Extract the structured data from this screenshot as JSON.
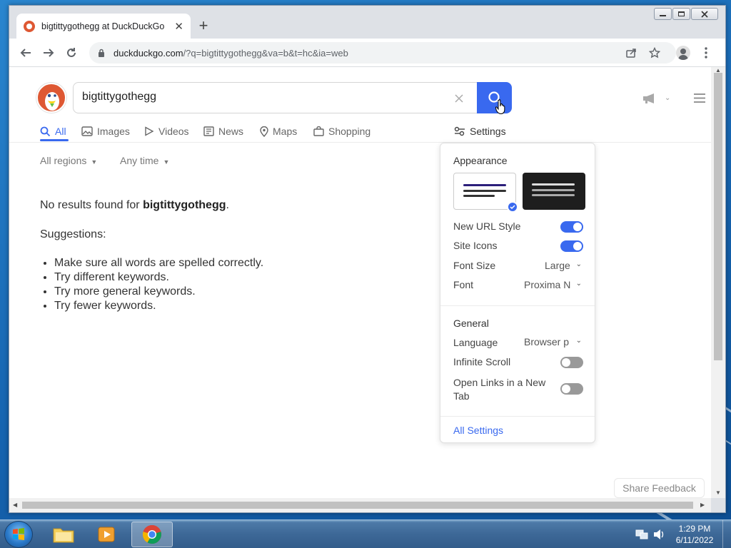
{
  "browser": {
    "tab_title": "bigtittygothegg at DuckDuckGo",
    "url_host": "duckduckgo.com",
    "url_rest": "/?q=bigtittygothegg&va=b&t=hc&ia=web"
  },
  "search": {
    "query": "bigtittygothegg"
  },
  "tabs": [
    {
      "label": "All"
    },
    {
      "label": "Images"
    },
    {
      "label": "Videos"
    },
    {
      "label": "News"
    },
    {
      "label": "Maps"
    },
    {
      "label": "Shopping"
    }
  ],
  "settings_tab_label": "Settings",
  "filters": {
    "region": "All regions",
    "time": "Any time"
  },
  "results": {
    "no_results_prefix": "No results found for ",
    "no_results_query": "bigtittygothegg",
    "no_results_suffix": ".",
    "suggestions_title": "Suggestions:",
    "suggestions": [
      "Make sure all words are spelled correctly.",
      "Try different keywords.",
      "Try more general keywords.",
      "Try fewer keywords."
    ]
  },
  "settings_panel": {
    "appearance_title": "Appearance",
    "new_url_style": {
      "label": "New URL Style",
      "on": true
    },
    "site_icons": {
      "label": "Site Icons",
      "on": true
    },
    "font_size": {
      "label": "Font Size",
      "value": "Large"
    },
    "font": {
      "label": "Font",
      "value": "Proxima N"
    },
    "general_title": "General",
    "language": {
      "label": "Language",
      "value": "Browser p"
    },
    "infinite_scroll": {
      "label": "Infinite Scroll",
      "on": false
    },
    "open_links": {
      "label_line1": "Open Links in a New",
      "label_line2": "Tab",
      "on": false
    },
    "all_settings": "All Settings"
  },
  "share_feedback": "Share Feedback",
  "taskbar": {
    "time": "1:29 PM",
    "date": "6/11/2022"
  },
  "colors": {
    "accent": "#3969ef",
    "ddg_orange": "#de5833"
  }
}
